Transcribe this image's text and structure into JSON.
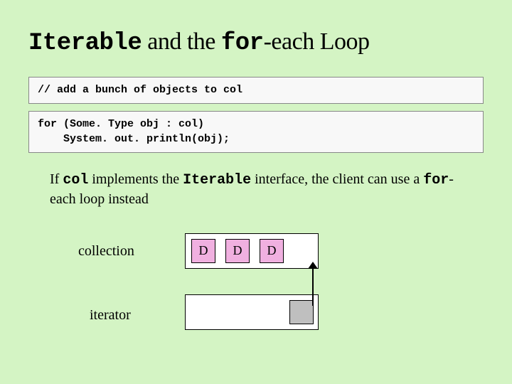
{
  "title": {
    "part1": "Iterable",
    "part2": " and the ",
    "part3": "for",
    "part4": "-each Loop"
  },
  "code1": "// add a bunch of objects to col",
  "code2": "for (Some. Type obj : col)\n    System. out. println(obj);",
  "para": {
    "t1": "If ",
    "c1": "col",
    "t2": " implements the ",
    "c2": "Iterable",
    "t3": " interface, the client can use a ",
    "c3": "for",
    "t4": "-each loop instead"
  },
  "diagram": {
    "collection_label": "collection",
    "iterator_label": "iterator",
    "d": "D"
  }
}
